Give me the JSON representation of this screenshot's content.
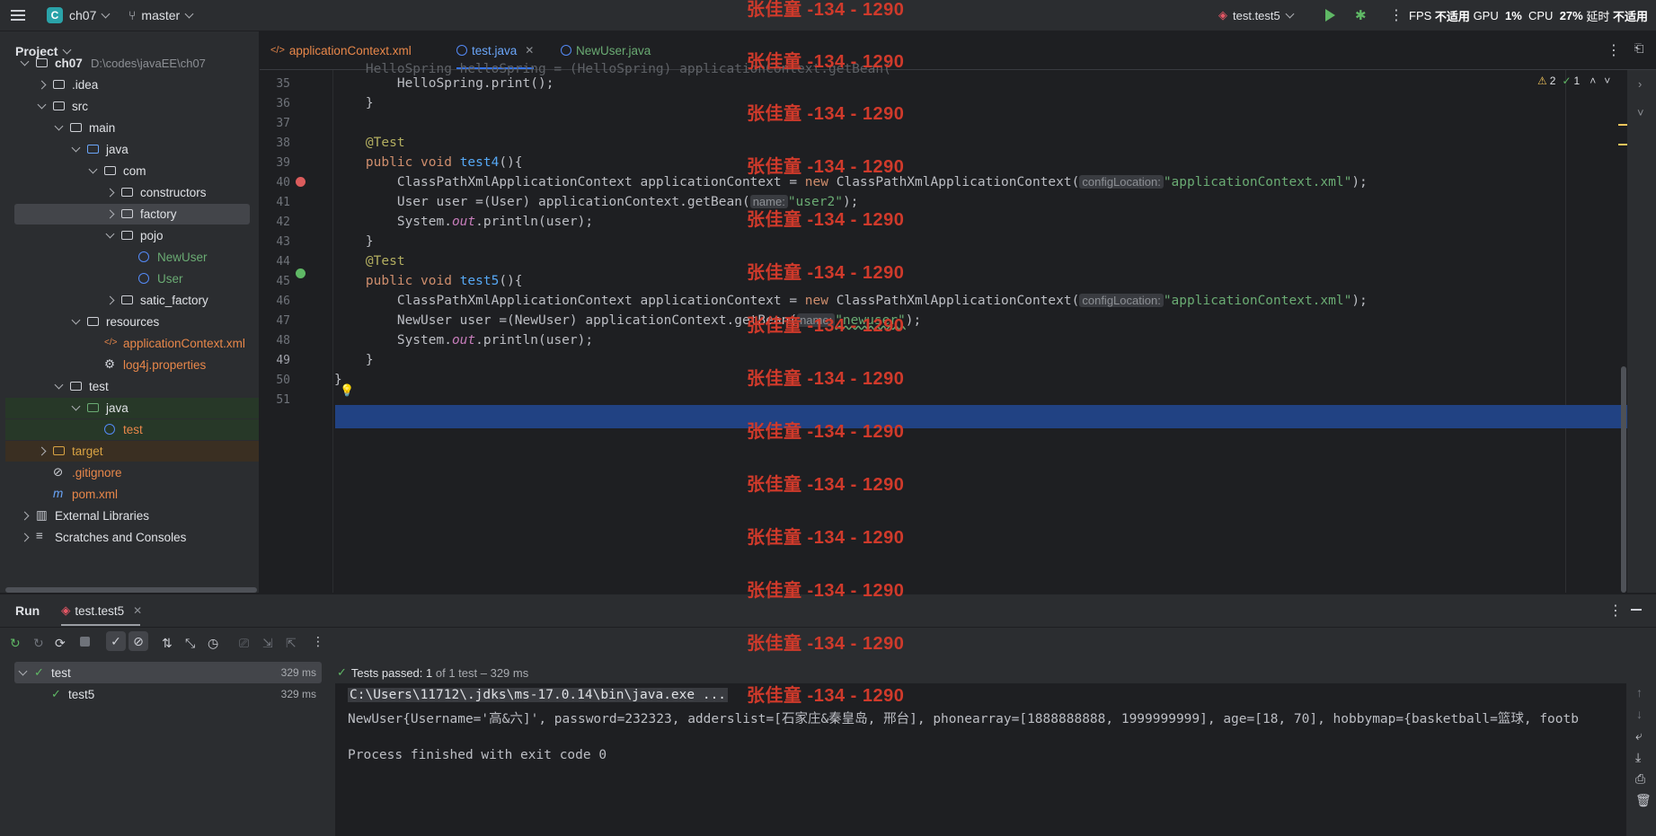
{
  "titlebar": {
    "project": "ch07",
    "project_badge": "C",
    "branch": "master",
    "run_config": "test.test5",
    "perf_fps": "FPS",
    "perf_fps_value": "不适用",
    "perf_gpu": "GPU",
    "perf_gpu_value": "1%",
    "perf_cpu": "CPU",
    "perf_cpu_value": "27%",
    "perf_latency": "延时",
    "perf_latency_value": "不适用"
  },
  "project_panel": {
    "title": "Project",
    "tree": [
      {
        "label": "ch07",
        "extra": "D:\\codes\\javaEE\\ch07"
      },
      {
        "label": ".idea"
      },
      {
        "label": "src"
      },
      {
        "label": "main"
      },
      {
        "label": "java"
      },
      {
        "label": "com"
      },
      {
        "label": "constructors"
      },
      {
        "label": "factory"
      },
      {
        "label": "pojo"
      },
      {
        "label": "NewUser"
      },
      {
        "label": "User"
      },
      {
        "label": "satic_factory"
      },
      {
        "label": "resources"
      },
      {
        "label": "applicationContext.xml"
      },
      {
        "label": "log4j.properties"
      },
      {
        "label": "test"
      },
      {
        "label": "java"
      },
      {
        "label": "test"
      },
      {
        "label": "target"
      },
      {
        "label": ".gitignore"
      },
      {
        "label": "pom.xml"
      },
      {
        "label": "External Libraries"
      },
      {
        "label": "Scratches and Consoles"
      }
    ]
  },
  "editor": {
    "tabs": [
      "applicationContext.xml",
      "test.java",
      "NewUser.java"
    ],
    "problems_warnings": "2",
    "problems_ok": "1",
    "line_numbers": [
      "35",
      "36",
      "37",
      "38",
      "39",
      "40",
      "41",
      "42",
      "43",
      "44",
      "45",
      "46",
      "47",
      "48",
      "49",
      "50",
      "51"
    ],
    "code": {
      "l35": "HelloSpring.print();",
      "l36": "}",
      "l38": "@Test",
      "l39_kw": "public void ",
      "l39_fn": "test4",
      "l39_end": "(){",
      "l40_a": "ClassPathXmlApplicationContext applicationContext = ",
      "l40_new": "new",
      "l40_b": " ClassPathXmlApplicationContext(",
      "l40_hint": "configLocation:",
      "l40_str": "\"applicationContext.xml\"",
      "l40_end": ");",
      "l41_a": "User user =(User) applicationContext.getBean(",
      "l41_hint": "name:",
      "l41_str": "\"user2\"",
      "l41_end": ");",
      "l42_a": "System.",
      "l42_out": "out",
      "l42_b": ".println(user);",
      "l43": "}",
      "l44": "@Test",
      "l45_kw": "public void ",
      "l45_fn": "test5",
      "l45_end": "(){",
      "l47_a": "NewUser user =(NewUser) applicationContext.getBean(",
      "l47_hint": "name:",
      "l47_str": "\"newuser\"",
      "l47_end": ");",
      "l48_a": "System.",
      "l48_out": "out",
      "l48_b": ".println(user);",
      "l49": "}",
      "l50": "}"
    }
  },
  "run_panel": {
    "title": "Run",
    "tab": "test.test5",
    "status_prefix": "Tests passed:",
    "status_count": "1",
    "status_suffix": "of 1 test – 329 ms",
    "tree": [
      {
        "label": "test",
        "time": "329 ms"
      },
      {
        "label": "test5",
        "time": "329 ms"
      }
    ],
    "console": [
      "C:\\Users\\11712\\.jdks\\ms-17.0.14\\bin\\java.exe ...",
      "NewUser{Username='高&六]', password=232323, adderslist=[石家庄&秦皇岛, 邢台], phonearray=[1888888888, 1999999999], age=[18, 70], hobbymap={basketball=篮球, footb",
      "",
      "Process finished with exit code 0"
    ]
  },
  "watermark": "张佳童 -134 - 1290",
  "colors": {
    "accent": "#214283",
    "keyword": "#cf8e6d",
    "string": "#6aab73",
    "function": "#56a8f5",
    "watermark": "#d03a2b"
  }
}
